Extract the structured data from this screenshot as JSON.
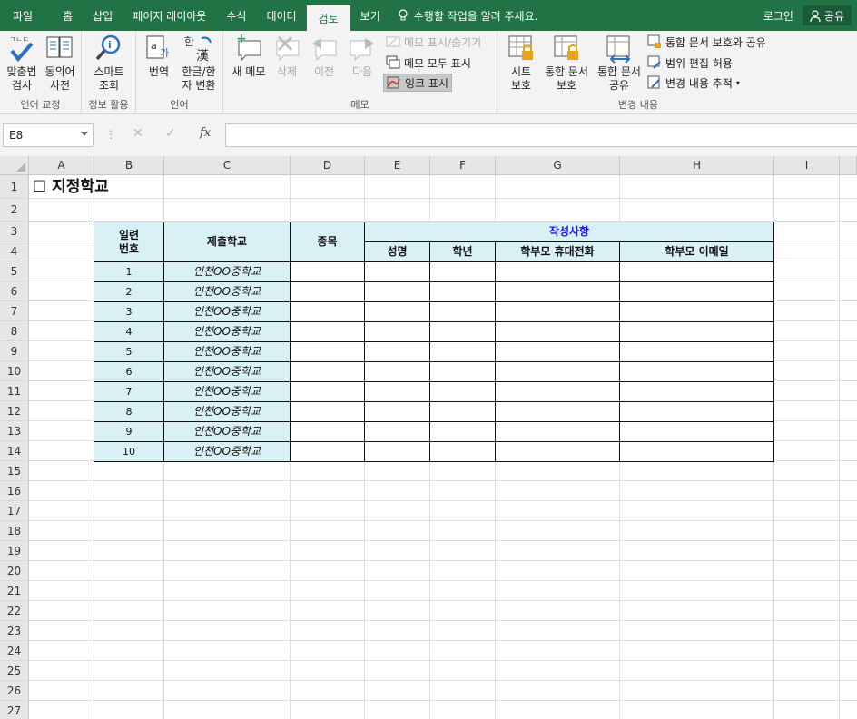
{
  "tabs": [
    "파일",
    "홈",
    "삽입",
    "페이지 레이아웃",
    "수식",
    "데이터",
    "검토",
    "보기"
  ],
  "active_tab": "검토",
  "tell_me": "수행할 작업을 알려 주세요.",
  "login": "로그인",
  "share": "공유",
  "ribbon": {
    "groups": {
      "proofing": "언어 교정",
      "insights": "정보 활용",
      "language": "언어",
      "comments": "메모",
      "changes": "변경 내용"
    },
    "spell_line1": "맞춤법",
    "spell_line2": "검사",
    "thesaurus_line1": "동의어",
    "thesaurus_line2": "사전",
    "smart_line1": "스마트",
    "smart_line2": "조회",
    "translate": "번역",
    "hanja_line1": "한글/한",
    "hanja_line2": "자 변환",
    "new_comment": "새 메모",
    "delete": "삭제",
    "previous": "이전",
    "next": "다음",
    "show_hide_comment": "메모 표시/숨기기",
    "show_all_comments": "메모 모두 표시",
    "show_ink": "잉크 표시",
    "protect_sheet_line1": "시트",
    "protect_sheet_line2": "보호",
    "protect_wb_line1": "통합 문서",
    "protect_wb_line2": "보호",
    "share_wb_line1": "통합 문서",
    "share_wb_line2": "공유",
    "protect_share": "통합 문서 보호와 공유",
    "allow_edit": "범위 편집 허용",
    "track_changes": "변경 내용 추적"
  },
  "formula_bar": {
    "name_box": "E8",
    "fx": "fx",
    "value": ""
  },
  "columns": [
    "A",
    "B",
    "C",
    "D",
    "E",
    "F",
    "G",
    "H",
    "I"
  ],
  "rows": [
    "1",
    "2",
    "3",
    "4",
    "5",
    "6",
    "7",
    "8",
    "9",
    "10",
    "11",
    "12",
    "13",
    "14",
    "15",
    "16",
    "17",
    "18",
    "19",
    "20",
    "21",
    "22",
    "23",
    "24",
    "25",
    "26",
    "27"
  ],
  "sheet": {
    "title": "☐ 지정학교",
    "header": {
      "serial_line1": "일련",
      "serial_line2": "번호",
      "school": "제출학교",
      "event": "종목",
      "details": "작성사항",
      "name": "성명",
      "grade": "학년",
      "parent_phone": "학부모 휴대전화",
      "parent_email": "학부모 이메일"
    },
    "records": [
      {
        "no": "1",
        "school": "인천OO중학교"
      },
      {
        "no": "2",
        "school": "인천OO중학교"
      },
      {
        "no": "3",
        "school": "인천OO중학교"
      },
      {
        "no": "4",
        "school": "인천OO중학교"
      },
      {
        "no": "5",
        "school": "인천OO중학교"
      },
      {
        "no": "6",
        "school": "인천OO중학교"
      },
      {
        "no": "7",
        "school": "인천OO중학교"
      },
      {
        "no": "8",
        "school": "인천OO중학교"
      },
      {
        "no": "9",
        "school": "인천OO중학교"
      },
      {
        "no": "10",
        "school": "인천OO중학교"
      }
    ]
  },
  "colors": {
    "ribbon_green": "#217346",
    "header_fill": "#d9f0f5",
    "details_text": "#1a1aff"
  }
}
